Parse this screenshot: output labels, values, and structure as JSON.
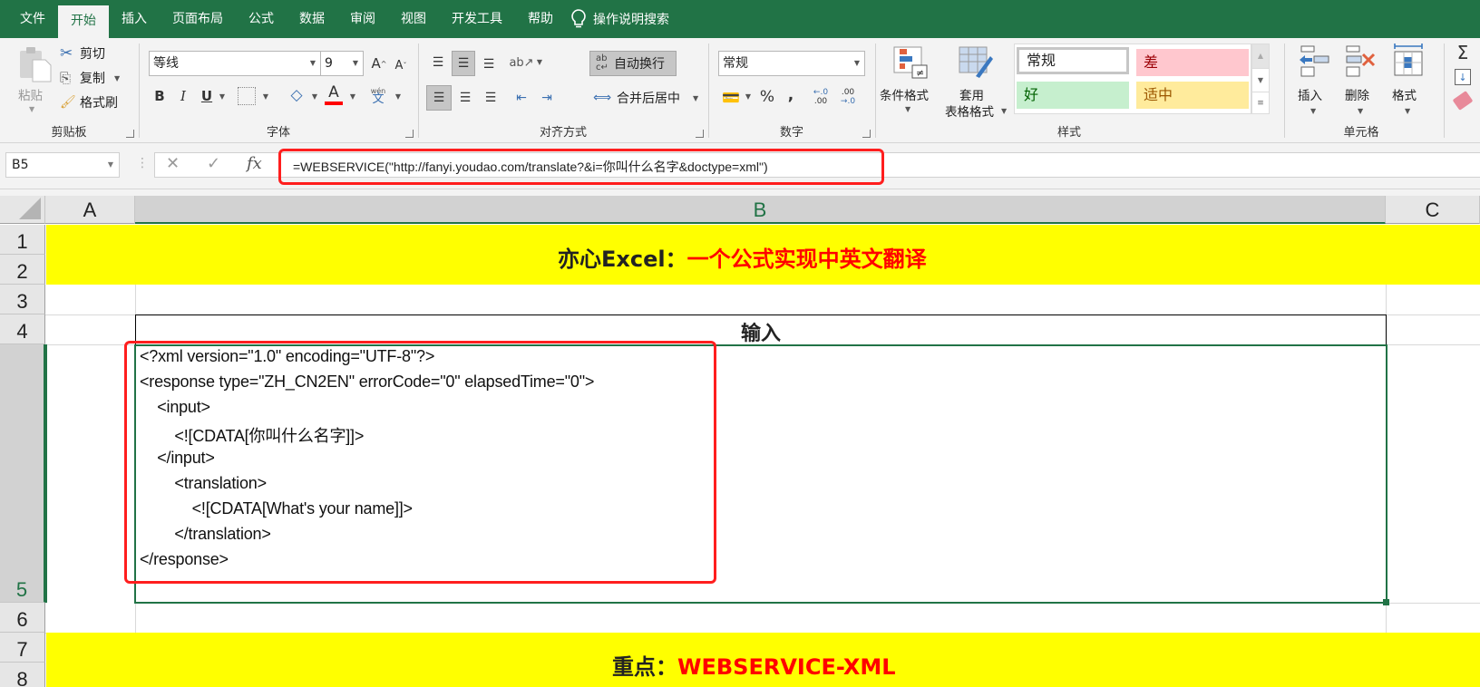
{
  "menu": {
    "tabs": [
      {
        "label": "文件",
        "active": false
      },
      {
        "label": "开始",
        "active": true
      },
      {
        "label": "插入",
        "active": false
      },
      {
        "label": "页面布局",
        "active": false
      },
      {
        "label": "公式",
        "active": false
      },
      {
        "label": "数据",
        "active": false
      },
      {
        "label": "审阅",
        "active": false
      },
      {
        "label": "视图",
        "active": false
      },
      {
        "label": "开发工具",
        "active": false
      },
      {
        "label": "帮助",
        "active": false
      }
    ],
    "tell_me": "操作说明搜索"
  },
  "ribbon": {
    "clipboard": {
      "label": "剪贴板",
      "paste": "粘贴",
      "cut": "剪切",
      "copy": "复制",
      "format_painter": "格式刷"
    },
    "font": {
      "label": "字体",
      "font_name": "等线",
      "font_size": "9",
      "bold": "B",
      "italic": "I",
      "underline": "U",
      "font_color": "#ff0000",
      "phonetic": "wén"
    },
    "alignment": {
      "label": "对齐方式",
      "wrap_text": "自动换行",
      "merge_center": "合并后居中"
    },
    "number": {
      "label": "数字",
      "format": "常规",
      "percent": "%",
      "comma": ",",
      "inc_decimal": ".00",
      "dec_decimal": ".0"
    },
    "styles": {
      "label": "样式",
      "conditional_format": "条件格式",
      "format_as_table_1": "套用",
      "format_as_table_2": "表格格式",
      "cells": [
        {
          "label": "常规",
          "bg": "#ffffff",
          "color": "#000000"
        },
        {
          "label": "差",
          "bg": "#ffc7ce",
          "color": "#9c0006"
        },
        {
          "label": "好",
          "bg": "#c6efce",
          "color": "#006100"
        },
        {
          "label": "适中",
          "bg": "#ffeb9c",
          "color": "#9c5700"
        }
      ]
    },
    "cells": {
      "label": "单元格",
      "insert": "插入",
      "delete": "删除",
      "format": "格式"
    },
    "editing": {
      "sum": "Σ"
    }
  },
  "formula_bar": {
    "name_box": "B5",
    "cancel": "✕",
    "enter": "✓",
    "fx": "fx",
    "formula": "=WEBSERVICE(\"http://fanyi.youdao.com/translate?&i=你叫什么名字&doctype=xml\")"
  },
  "sheet": {
    "columns": [
      "A",
      "B",
      "C"
    ],
    "selected_column": "B",
    "rows": [
      "1",
      "2",
      "3",
      "4",
      "5",
      "6",
      "7",
      "8"
    ],
    "selected_row": "5",
    "title_prefix": "亦心Excel：",
    "title_accent": "一个公式实现中英文翻译",
    "input_header": "输入",
    "xml_lines": [
      "<?xml version=\"1.0\" encoding=\"UTF-8\"?>",
      "<response type=\"ZH_CN2EN\" errorCode=\"0\" elapsedTime=\"0\">",
      "    <input>",
      "        <![CDATA[你叫什么名字]]>",
      "    </input>",
      "        <translation>",
      "            <![CDATA[What's your name]]>",
      "        </translation>",
      "</response>"
    ],
    "footer_prefix": "重点：",
    "footer_accent": "WEBSERVICE-XML",
    "band_color": "#ffff00",
    "accent_color": "#ff0000"
  },
  "theme": {
    "brand": "#217346",
    "highlight_box": "#ff1e1e"
  }
}
